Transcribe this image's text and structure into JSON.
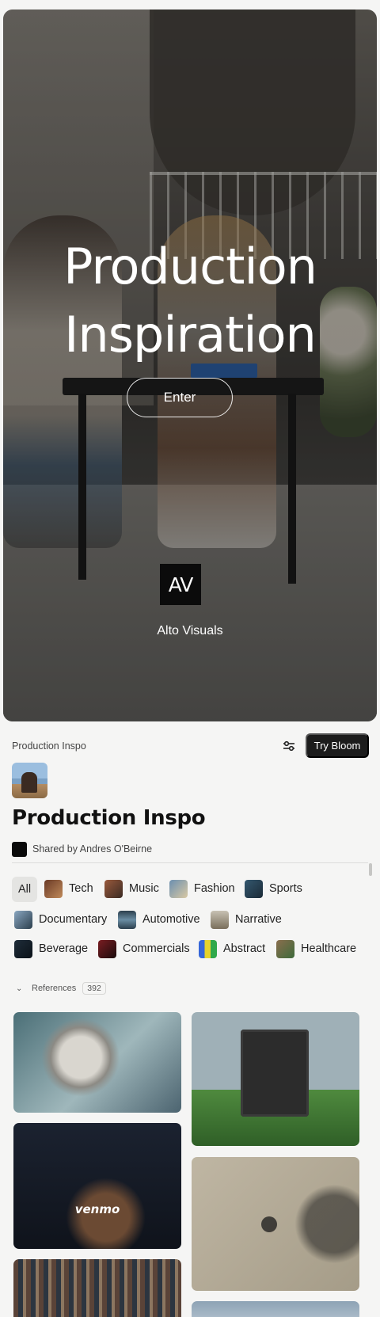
{
  "hero": {
    "title": "Production Inspiration",
    "enter_label": "Enter",
    "logo_text": "AV",
    "brand_name": "Alto Visuals"
  },
  "topbar": {
    "breadcrumb": "Production Inspo",
    "try_label": "Try Bloom"
  },
  "board": {
    "title": "Production Inspo",
    "shared_by": "Shared by Andres O'Beirne"
  },
  "categories": [
    {
      "label": "All",
      "selected": true
    },
    {
      "label": "Tech",
      "color": "#6a3a26"
    },
    {
      "label": "Music",
      "color": "#9a5a3d"
    },
    {
      "label": "Fashion",
      "color": "#6b8fb0"
    },
    {
      "label": "Sports",
      "color": "#34586f"
    },
    {
      "label": "Documentary",
      "color": "#8aa7c1"
    },
    {
      "label": "Automotive",
      "color": "#2c3f4d"
    },
    {
      "label": "Narrative",
      "color": "#a39984"
    },
    {
      "label": "Beverage",
      "color": "#1f2d3a"
    },
    {
      "label": "Commercials",
      "color": "#7a1d22"
    },
    {
      "label": "Abstract",
      "color": "#3566d8"
    },
    {
      "label": "Healthcare",
      "color": "#8b6e4e"
    }
  ],
  "references": {
    "label": "References",
    "count": "392"
  },
  "media": [
    {
      "name": "astronaut-reference"
    },
    {
      "name": "speaker-grass-reference"
    },
    {
      "name": "venmo-reference",
      "caption": "venmo"
    },
    {
      "name": "shadow-soccer-reference"
    },
    {
      "name": "crowd-reference"
    },
    {
      "name": "partial-reference"
    }
  ]
}
